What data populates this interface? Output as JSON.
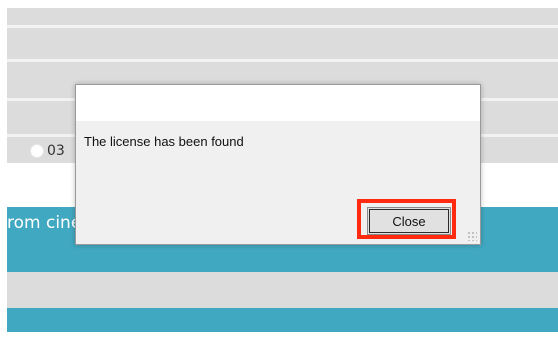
{
  "background": {
    "radio_option_label": "03",
    "teal_bar_text": "rom cine"
  },
  "dialog": {
    "message": "The license has been found",
    "close_label": "Close"
  },
  "colors": {
    "teal": "#41a8c1",
    "highlight": "#ff2a0f",
    "row_gray": "#dcdcdc"
  }
}
